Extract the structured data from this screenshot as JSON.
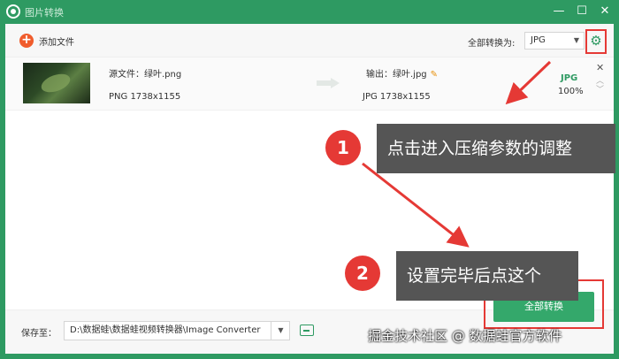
{
  "window": {
    "title": "图片转换",
    "controls": {
      "minimize": "—",
      "maximize": "☐",
      "close": "✕"
    }
  },
  "toolbar": {
    "add_file_label": "添加文件",
    "convert_all_label": "全部转换为:",
    "format_value": "JPG"
  },
  "file": {
    "source_name": "源文件：绿叶.png",
    "source_meta": "PNG   1738x1155",
    "output_name": "输出：绿叶.jpg",
    "output_meta": "JPG   1738x1155",
    "format_badge": "JPG",
    "quality": "100%"
  },
  "bottom": {
    "save_label": "保存至：",
    "save_path": "D:\\数据蛙\\数据蛙视频转换器\\Image Converter",
    "convert_button": "全部转换"
  },
  "annotations": {
    "step1_number": "1",
    "step1_text": "点击进入压缩参数的调整",
    "step2_number": "2",
    "step2_text": "设置完毕后点这个"
  },
  "watermark": "掘金技术社区 @ 数据蛙官方软件",
  "colors": {
    "brand": "#2e9a62",
    "accent": "#f05c2c",
    "annotation_red": "#e53935"
  }
}
